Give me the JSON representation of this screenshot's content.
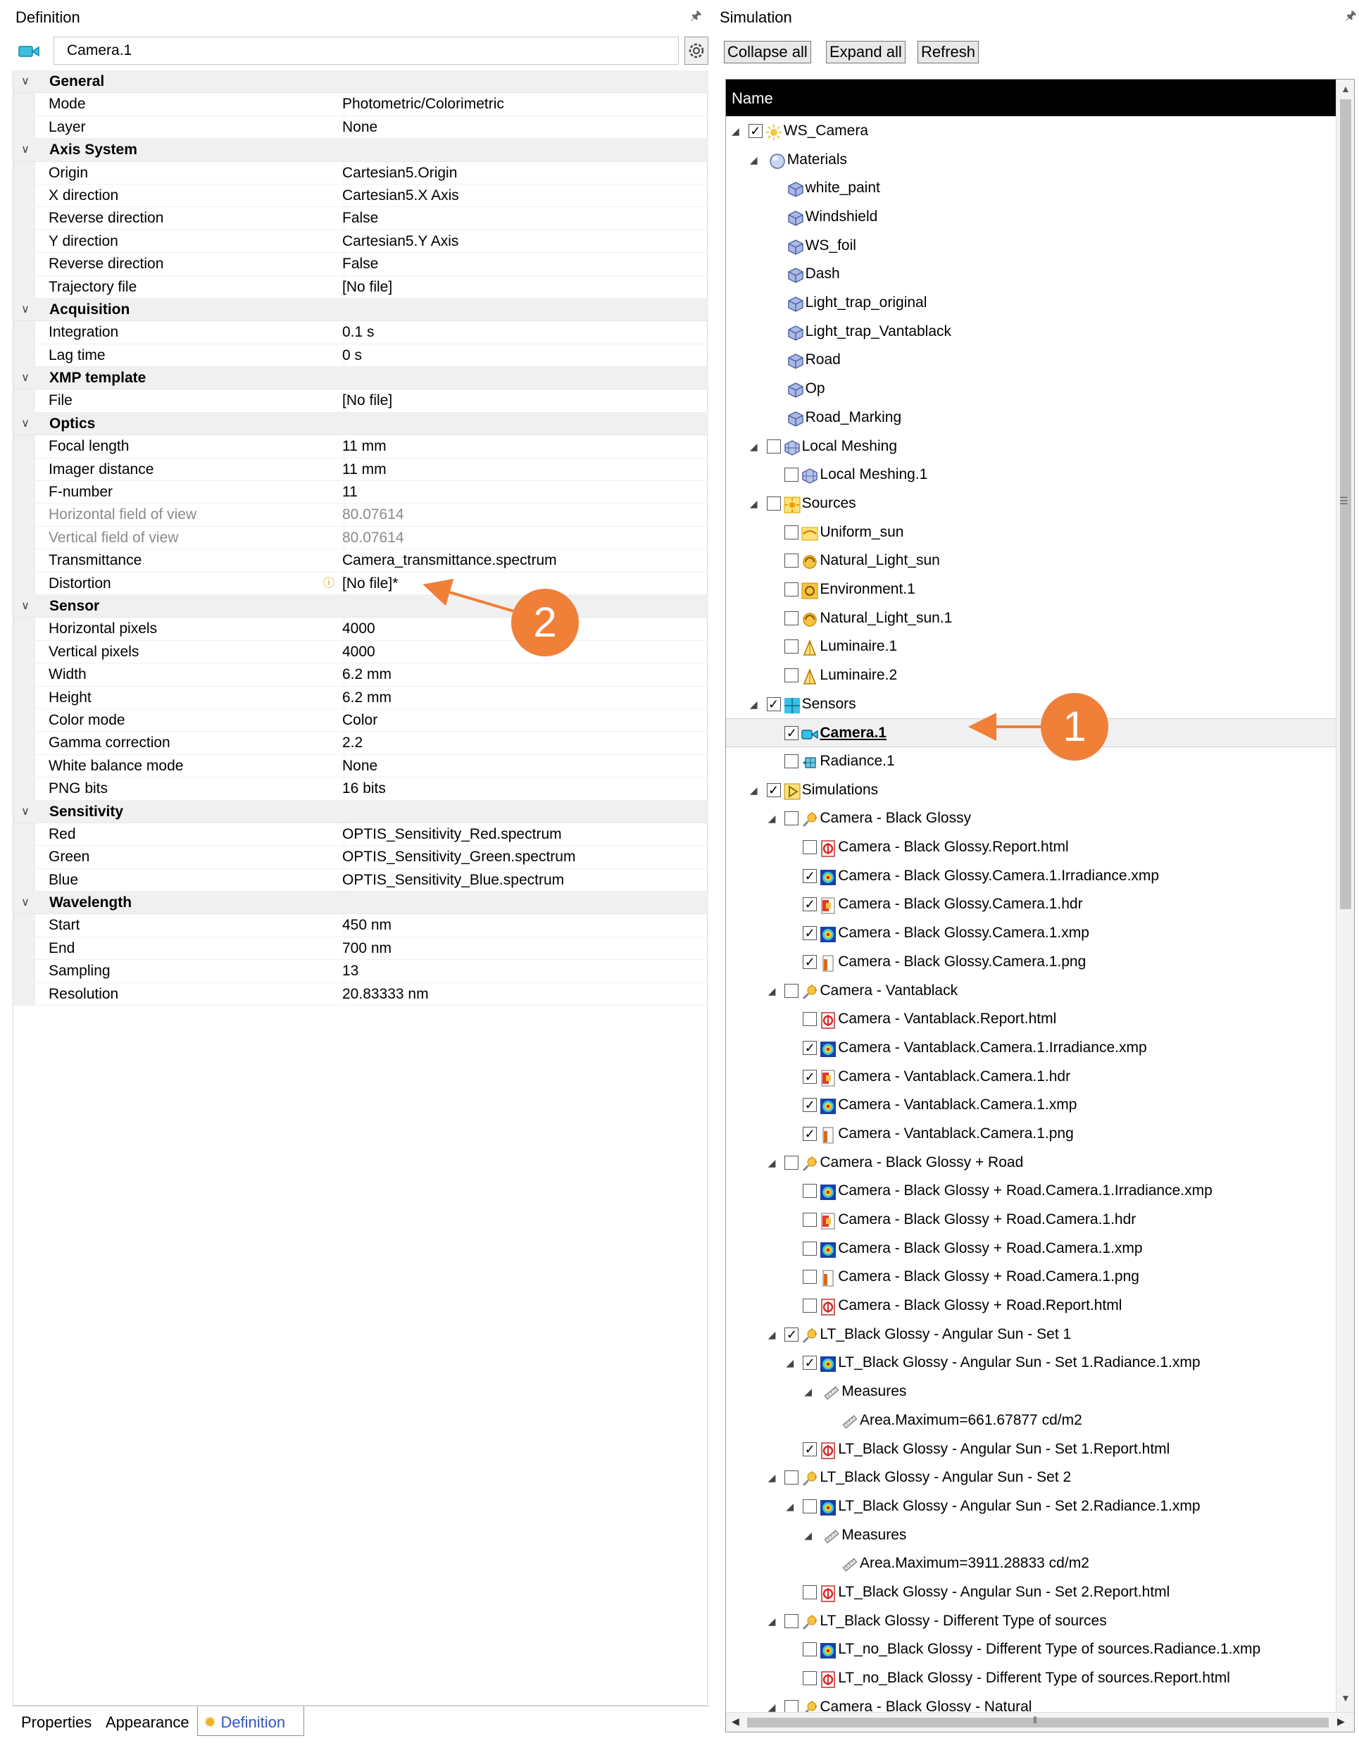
{
  "definition": {
    "title": "Definition",
    "name_value": "Camera.1",
    "categories": [
      {
        "label": "General",
        "props": [
          {
            "name": "Mode",
            "value": "Photometric/Colorimetric"
          },
          {
            "name": "Layer",
            "value": "None"
          }
        ]
      },
      {
        "label": "Axis System",
        "props": [
          {
            "name": "Origin",
            "value": "Cartesian5.Origin"
          },
          {
            "name": "X direction",
            "value": "Cartesian5.X Axis"
          },
          {
            "name": "Reverse direction",
            "value": "False"
          },
          {
            "name": "Y direction",
            "value": "Cartesian5.Y Axis"
          },
          {
            "name": "Reverse direction",
            "value": "False"
          },
          {
            "name": "Trajectory file",
            "value": "[No file]"
          }
        ]
      },
      {
        "label": "Acquisition",
        "props": [
          {
            "name": "Integration",
            "value": "0.1 s"
          },
          {
            "name": "Lag time",
            "value": "0 s"
          }
        ]
      },
      {
        "label": "XMP template",
        "props": [
          {
            "name": "File",
            "value": "[No file]"
          }
        ]
      },
      {
        "label": "Optics",
        "props": [
          {
            "name": "Focal length",
            "value": "11 mm"
          },
          {
            "name": "Imager distance",
            "value": "11 mm"
          },
          {
            "name": "F-number",
            "value": "11"
          },
          {
            "name": "Horizontal field of view",
            "value": "80.07614",
            "readonly": true
          },
          {
            "name": "Vertical field of view",
            "value": "80.07614",
            "readonly": true
          },
          {
            "name": "Transmittance",
            "value": "Camera_transmittance.spectrum"
          },
          {
            "name": "Distortion",
            "value": "[No file]*",
            "info": true
          }
        ]
      },
      {
        "label": "Sensor",
        "props": [
          {
            "name": "Horizontal pixels",
            "value": "4000"
          },
          {
            "name": "Vertical pixels",
            "value": "4000"
          },
          {
            "name": "Width",
            "value": "6.2 mm"
          },
          {
            "name": "Height",
            "value": "6.2 mm"
          },
          {
            "name": "Color mode",
            "value": "Color"
          },
          {
            "name": "Gamma correction",
            "value": "2.2"
          },
          {
            "name": "White balance mode",
            "value": "None"
          },
          {
            "name": "PNG bits",
            "value": "16 bits"
          }
        ]
      },
      {
        "label": "Sensitivity",
        "props": [
          {
            "name": "Red",
            "value": "OPTIS_Sensitivity_Red.spectrum"
          },
          {
            "name": "Green",
            "value": "OPTIS_Sensitivity_Green.spectrum"
          },
          {
            "name": "Blue",
            "value": "OPTIS_Sensitivity_Blue.spectrum"
          }
        ]
      },
      {
        "label": "Wavelength",
        "props": [
          {
            "name": "Start",
            "value": "450 nm"
          },
          {
            "name": "End",
            "value": "700 nm"
          },
          {
            "name": "Sampling",
            "value": "13"
          },
          {
            "name": "Resolution",
            "value": "20.83333 nm"
          }
        ]
      }
    ],
    "tabs": {
      "properties": "Properties",
      "appearance": "Appearance",
      "definition": "Definition"
    }
  },
  "simulation": {
    "title": "Simulation",
    "buttons": {
      "collapse": "Collapse all",
      "expand": "Expand all",
      "refresh": "Refresh"
    },
    "column_header": "Name",
    "tree": [
      {
        "level": 0,
        "exp": true,
        "check": "checked",
        "icon": "sun-icon",
        "label": "WS_Camera"
      },
      {
        "level": 1,
        "exp": true,
        "check": "none",
        "icon": "sphere-icon",
        "label": "Materials"
      },
      {
        "level": 2,
        "exp": false,
        "check": "none",
        "icon": "cube-icon",
        "label": "white_paint"
      },
      {
        "level": 2,
        "exp": false,
        "check": "none",
        "icon": "cube-icon",
        "label": "Windshield"
      },
      {
        "level": 2,
        "exp": false,
        "check": "none",
        "icon": "cube-icon",
        "label": "WS_foil"
      },
      {
        "level": 2,
        "exp": false,
        "check": "none",
        "icon": "cube-icon",
        "label": "Dash"
      },
      {
        "level": 2,
        "exp": false,
        "check": "none",
        "icon": "cube-icon",
        "label": "Light_trap_original"
      },
      {
        "level": 2,
        "exp": false,
        "check": "none",
        "icon": "cube-icon",
        "label": "Light_trap_Vantablack"
      },
      {
        "level": 2,
        "exp": false,
        "check": "none",
        "icon": "cube-icon",
        "label": "Road"
      },
      {
        "level": 2,
        "exp": false,
        "check": "none",
        "icon": "cube-icon",
        "label": "Op"
      },
      {
        "level": 2,
        "exp": false,
        "check": "none",
        "icon": "cube-icon",
        "label": "Road_Marking"
      },
      {
        "level": 1,
        "exp": true,
        "check": "unchecked",
        "icon": "mesh-icon",
        "label": "Local Meshing"
      },
      {
        "level": 2,
        "exp": false,
        "check": "unchecked",
        "icon": "mesh-icon",
        "label": "Local Meshing.1"
      },
      {
        "level": 1,
        "exp": true,
        "check": "unchecked",
        "icon": "sources-icon",
        "label": "Sources"
      },
      {
        "level": 2,
        "exp": false,
        "check": "unchecked",
        "icon": "uniform-sun-icon",
        "label": "Uniform_sun"
      },
      {
        "level": 2,
        "exp": false,
        "check": "unchecked",
        "icon": "natural-light-icon",
        "label": "Natural_Light_sun"
      },
      {
        "level": 2,
        "exp": false,
        "check": "unchecked",
        "icon": "environment-icon",
        "label": "Environment.1"
      },
      {
        "level": 2,
        "exp": false,
        "check": "unchecked",
        "icon": "natural-light-icon",
        "label": "Natural_Light_sun.1"
      },
      {
        "level": 2,
        "exp": false,
        "check": "unchecked",
        "icon": "luminaire-icon",
        "label": "Luminaire.1"
      },
      {
        "level": 2,
        "exp": false,
        "check": "unchecked",
        "icon": "luminaire-icon",
        "label": "Luminaire.2"
      },
      {
        "level": 1,
        "exp": true,
        "check": "checked",
        "icon": "sensors-icon",
        "label": "Sensors"
      },
      {
        "level": 2,
        "exp": false,
        "check": "checked",
        "icon": "camera-icon",
        "label": "Camera.1",
        "selected": true
      },
      {
        "level": 2,
        "exp": false,
        "check": "unchecked",
        "icon": "radiance-icon",
        "label": "Radiance.1"
      },
      {
        "level": 1,
        "exp": true,
        "check": "checked",
        "icon": "simulations-icon",
        "label": "Simulations"
      },
      {
        "level": 2,
        "exp": true,
        "check": "unchecked",
        "icon": "simulation-icon",
        "label": "Camera -  Black Glossy"
      },
      {
        "level": 3,
        "exp": false,
        "check": "unchecked",
        "icon": "report-icon",
        "label": "Camera -  Black Glossy.Report.html"
      },
      {
        "level": 3,
        "exp": false,
        "check": "checked",
        "icon": "xmp-icon",
        "label": "Camera -  Black Glossy.Camera.1.Irradiance.xmp"
      },
      {
        "level": 3,
        "exp": false,
        "check": "checked",
        "icon": "hdr-icon",
        "label": "Camera -  Black Glossy.Camera.1.hdr"
      },
      {
        "level": 3,
        "exp": false,
        "check": "checked",
        "icon": "xmp-icon",
        "label": "Camera -  Black Glossy.Camera.1.xmp"
      },
      {
        "level": 3,
        "exp": false,
        "check": "checked",
        "icon": "png-icon",
        "label": "Camera -  Black Glossy.Camera.1.png"
      },
      {
        "level": 2,
        "exp": true,
        "check": "unchecked",
        "icon": "simulation-icon",
        "label": "Camera - Vantablack"
      },
      {
        "level": 3,
        "exp": false,
        "check": "unchecked",
        "icon": "report-icon",
        "label": "Camera - Vantablack.Report.html"
      },
      {
        "level": 3,
        "exp": false,
        "check": "checked",
        "icon": "xmp-icon",
        "label": "Camera - Vantablack.Camera.1.Irradiance.xmp"
      },
      {
        "level": 3,
        "exp": false,
        "check": "checked",
        "icon": "hdr-icon",
        "label": "Camera - Vantablack.Camera.1.hdr"
      },
      {
        "level": 3,
        "exp": false,
        "check": "checked",
        "icon": "xmp-icon",
        "label": "Camera - Vantablack.Camera.1.xmp"
      },
      {
        "level": 3,
        "exp": false,
        "check": "checked",
        "icon": "png-icon",
        "label": "Camera - Vantablack.Camera.1.png"
      },
      {
        "level": 2,
        "exp": true,
        "check": "unchecked",
        "icon": "simulation-icon",
        "label": "Camera - Black Glossy + Road"
      },
      {
        "level": 3,
        "exp": false,
        "check": "unchecked",
        "icon": "xmp-icon",
        "label": "Camera - Black Glossy + Road.Camera.1.Irradiance.xmp"
      },
      {
        "level": 3,
        "exp": false,
        "check": "unchecked",
        "icon": "hdr-icon",
        "label": "Camera - Black Glossy + Road.Camera.1.hdr"
      },
      {
        "level": 3,
        "exp": false,
        "check": "unchecked",
        "icon": "xmp-icon",
        "label": "Camera - Black Glossy + Road.Camera.1.xmp"
      },
      {
        "level": 3,
        "exp": false,
        "check": "unchecked",
        "icon": "png-icon",
        "label": "Camera - Black Glossy + Road.Camera.1.png"
      },
      {
        "level": 3,
        "exp": false,
        "check": "unchecked",
        "icon": "report-icon",
        "label": "Camera - Black Glossy + Road.Report.html"
      },
      {
        "level": 2,
        "exp": true,
        "check": "checked",
        "icon": "simulation-icon",
        "label": "LT_Black Glossy - Angular Sun - Set 1"
      },
      {
        "level": 3,
        "exp": true,
        "check": "checked",
        "icon": "xmp-icon",
        "label": "LT_Black Glossy - Angular Sun - Set 1.Radiance.1.xmp"
      },
      {
        "level": 4,
        "exp": true,
        "check": "none",
        "icon": "measure-icon",
        "label": "Measures"
      },
      {
        "level": 5,
        "exp": false,
        "check": "none",
        "icon": "measure-icon",
        "label": "Area.Maximum=661.67877 cd/m2"
      },
      {
        "level": 3,
        "exp": false,
        "check": "checked",
        "icon": "report-icon",
        "label": "LT_Black Glossy - Angular Sun - Set 1.Report.html"
      },
      {
        "level": 2,
        "exp": true,
        "check": "unchecked",
        "icon": "simulation-icon",
        "label": "LT_Black Glossy - Angular Sun - Set 2"
      },
      {
        "level": 3,
        "exp": true,
        "check": "unchecked",
        "icon": "xmp-icon",
        "label": "LT_Black Glossy - Angular Sun - Set 2.Radiance.1.xmp"
      },
      {
        "level": 4,
        "exp": true,
        "check": "none",
        "icon": "measure-icon",
        "label": "Measures"
      },
      {
        "level": 5,
        "exp": false,
        "check": "none",
        "icon": "measure-icon",
        "label": "Area.Maximum=3911.28833 cd/m2"
      },
      {
        "level": 3,
        "exp": false,
        "check": "unchecked",
        "icon": "report-icon",
        "label": "LT_Black Glossy - Angular Sun - Set 2.Report.html"
      },
      {
        "level": 2,
        "exp": true,
        "check": "unchecked",
        "icon": "simulation-icon",
        "label": "LT_Black Glossy - Different Type of sources"
      },
      {
        "level": 3,
        "exp": false,
        "check": "unchecked",
        "icon": "xmp-icon",
        "label": "LT_no_Black Glossy - Different Type of sources.Radiance.1.xmp"
      },
      {
        "level": 3,
        "exp": false,
        "check": "unchecked",
        "icon": "report-icon",
        "label": "LT_no_Black Glossy - Different Type of sources.Report.html"
      },
      {
        "level": 2,
        "exp": true,
        "check": "unchecked",
        "icon": "simulation-icon",
        "label": "Camera -  Black Glossy - Natural"
      }
    ]
  },
  "annotations": {
    "badge_1": "1",
    "badge_2": "2",
    "color": "#f07f38"
  }
}
